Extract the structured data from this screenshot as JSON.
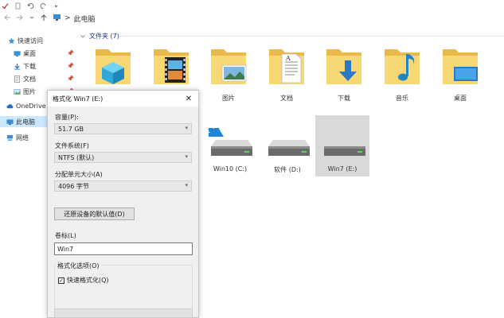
{
  "address": {
    "path_separator": ">",
    "location": "此电脑"
  },
  "nav": {
    "quick_access": "快速访问",
    "items": [
      {
        "label": "桌面",
        "pinned": true
      },
      {
        "label": "下载",
        "pinned": true
      },
      {
        "label": "文档",
        "pinned": true
      },
      {
        "label": "图片",
        "pinned": true
      }
    ],
    "onedrive": "OneDrive",
    "this_pc": "此电脑",
    "network": "网络",
    "pin_glyph": "📌"
  },
  "content": {
    "group_header": "文件夹 (7)",
    "folders": [
      {
        "label": "",
        "icon": "3d-objects-icon"
      },
      {
        "label": "",
        "icon": "videos-icon"
      },
      {
        "label": "图片",
        "icon": "pictures-icon"
      },
      {
        "label": "文档",
        "icon": "documents-icon"
      },
      {
        "label": "下载",
        "icon": "downloads-icon"
      },
      {
        "label": "音乐",
        "icon": "music-icon"
      },
      {
        "label": "桌面",
        "icon": "desktop-icon"
      }
    ],
    "drives": [
      {
        "label": "Win10 (C:)",
        "selected": false
      },
      {
        "label": "软件 (D:)",
        "selected": false
      },
      {
        "label": "Win7 (E:)",
        "selected": true
      }
    ]
  },
  "dialog": {
    "title": "格式化 Win7 (E:)",
    "close": "✕",
    "capacity_label": "容量(P):",
    "capacity_value": "51.7 GB",
    "filesystem_label": "文件系统(F)",
    "filesystem_value": "NTFS (默认)",
    "allocation_label": "分配单元大小(A)",
    "allocation_value": "4096 字节",
    "restore_button": "还原设备的默认值(D)",
    "volume_label": "卷标(L)",
    "volume_value": "Win7",
    "options_legend": "格式化选项(O)",
    "quick_format_label": "快速格式化(Q)",
    "quick_format_checked": true
  },
  "colors": {
    "accent_blue": "#1e3287",
    "selection": "#cce8ff",
    "folder_yellow": "#f8d775"
  }
}
